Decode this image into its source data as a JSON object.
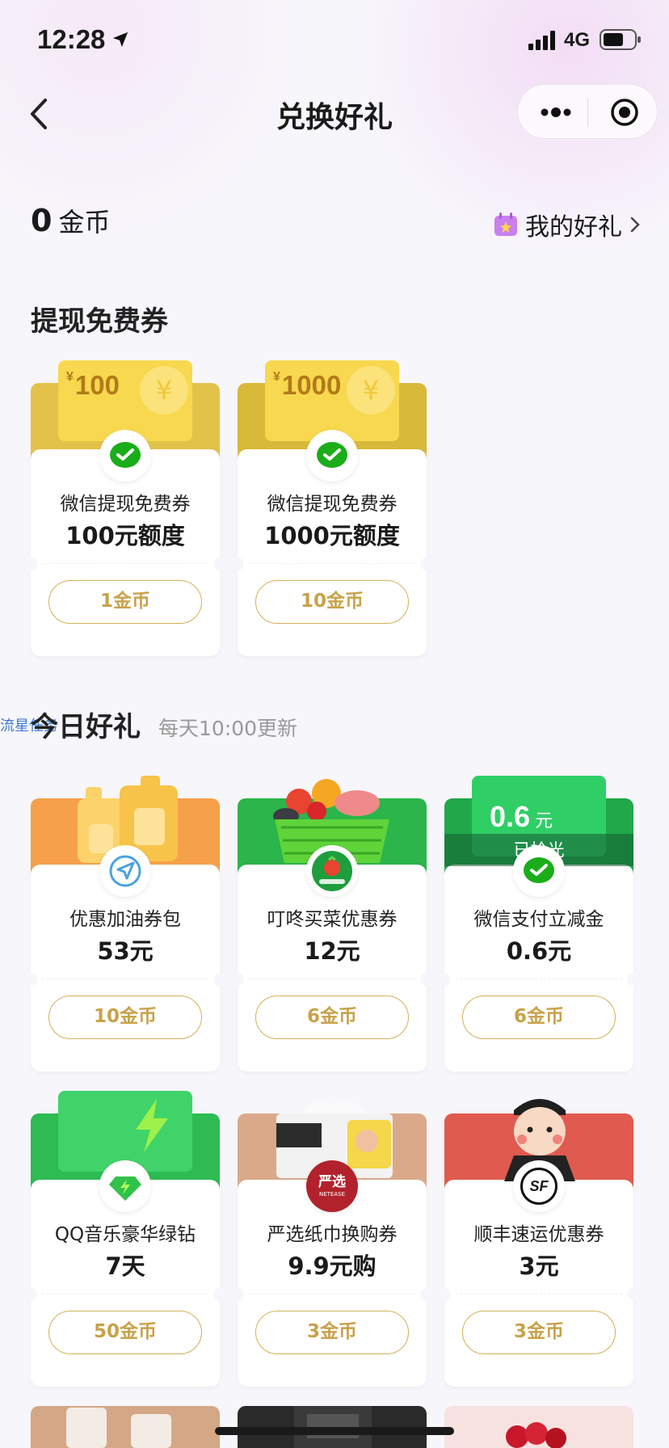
{
  "status_bar": {
    "time": "12:28",
    "network": "4G"
  },
  "nav": {
    "title": "兑换好礼"
  },
  "coins": {
    "count": "0",
    "unit": "金币",
    "my_gifts_label": "我的好礼"
  },
  "sections": {
    "free_coupons": {
      "title": "提现免费券"
    },
    "today": {
      "title": "今日好礼",
      "subtitle": "每天10:00更新"
    }
  },
  "floating_tag": "流星任务",
  "free_cards": [
    {
      "ticket_currency": "¥",
      "ticket_amount": "100",
      "name": "微信提现免费券",
      "value": "100元额度",
      "price": "1金币"
    },
    {
      "ticket_currency": "¥",
      "ticket_amount": "1000",
      "name": "微信提现免费券",
      "value": "1000元额度",
      "price": "10金币"
    }
  ],
  "today_cards": [
    {
      "name": "优惠加油券包",
      "value": "53元",
      "price": "10金币",
      "icon": "compass-icon"
    },
    {
      "name": "叮咚买菜优惠券",
      "value": "12元",
      "price": "6金币",
      "icon": "dingdong-logo"
    },
    {
      "name": "微信支付立减金",
      "value": "0.6元",
      "price": "6金币",
      "icon": "wechat-pay-icon",
      "ticket_amount": "0.6",
      "ticket_unit": "元",
      "soldout_label": "已抢光"
    },
    {
      "name": "QQ音乐豪华绿钻",
      "value": "7天",
      "price": "50金币",
      "icon": "green-diamond-icon"
    },
    {
      "name": "严选纸巾换购券",
      "value": "9.9元购",
      "price": "3金币",
      "icon": "yanxuan-logo",
      "logo_text": "严选",
      "logo_sub": "NETEASE"
    },
    {
      "name": "顺丰速运优惠券",
      "value": "3元",
      "price": "3金币",
      "icon": "sf-logo",
      "logo_text": "SF"
    }
  ],
  "colors": {
    "gold_button": "#c8a24a",
    "gold_ticket": "#f4cf43",
    "wechat_green": "#1aad19",
    "orange": "#f7a04b",
    "green": "#27b94a",
    "sf_red": "#e05a4f",
    "tan": "#d9a98a"
  }
}
